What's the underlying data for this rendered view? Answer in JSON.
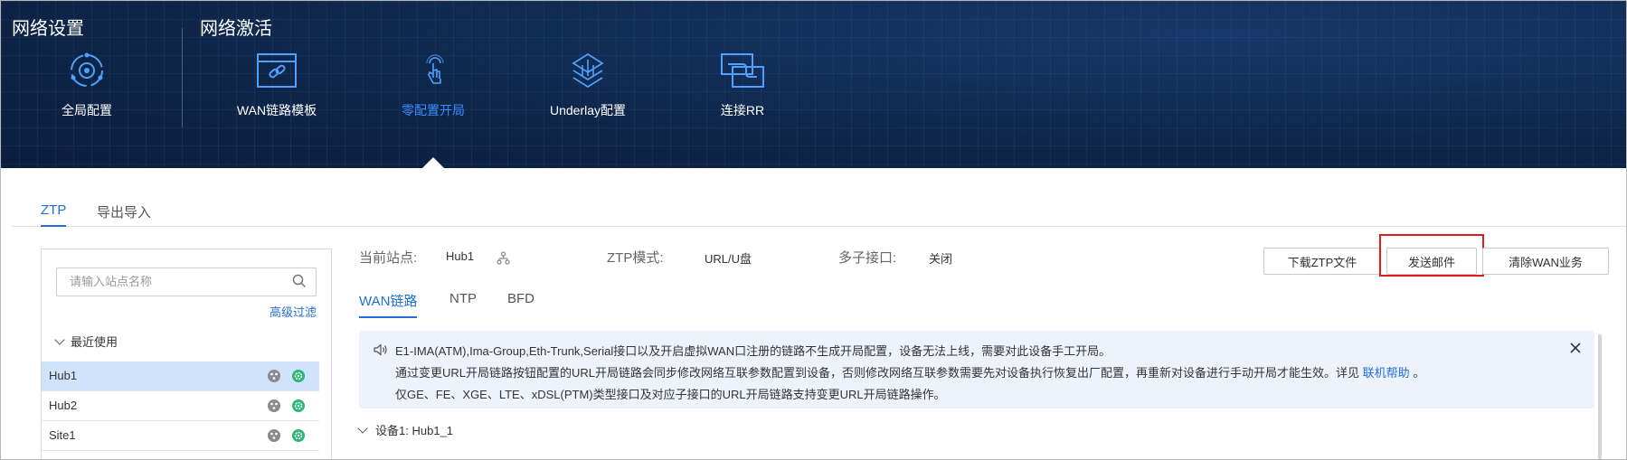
{
  "header": {
    "section_network_settings": "网络设置",
    "section_network_activation": "网络激活",
    "nav": [
      {
        "label": "全局配置",
        "icon": "gear-cycle-icon",
        "active": false
      },
      {
        "label": "WAN链路模板",
        "icon": "link-template-icon",
        "active": false
      },
      {
        "label": "零配置开局",
        "icon": "touch-hand-icon",
        "active": true
      },
      {
        "label": "Underlay配置",
        "icon": "layers-network-icon",
        "active": false
      },
      {
        "label": "连接RR",
        "icon": "connect-rr-icon",
        "active": false
      }
    ]
  },
  "tabs_top": [
    {
      "label": "ZTP",
      "active": true
    },
    {
      "label": "导出导入",
      "active": false
    }
  ],
  "left_panel": {
    "search_placeholder": "请输入站点名称",
    "advanced_filter": "高级过滤",
    "recent_label": "最近使用",
    "sites": [
      {
        "name": "Hub1",
        "selected": true
      },
      {
        "name": "Hub2",
        "selected": false
      },
      {
        "name": "Site1",
        "selected": false
      }
    ]
  },
  "info": {
    "current_site_label": "当前站点:",
    "current_site_value": "Hub1",
    "ztp_mode_label": "ZTP模式:",
    "ztp_mode_value": "URL/U盘",
    "multi_sub_label": "多子接口:",
    "multi_sub_value": "关闭"
  },
  "buttons": {
    "download_ztp": "下载ZTP文件",
    "send_email": "发送邮件",
    "clear_wan": "清除WAN业务"
  },
  "tabs_sub": [
    {
      "label": "WAN链路",
      "active": true
    },
    {
      "label": "NTP",
      "active": false
    },
    {
      "label": "BFD",
      "active": false
    }
  ],
  "notice": {
    "line1": "E1-IMA(ATM),Ima-Group,Eth-Trunk,Serial接口以及开启虚拟WAN口注册的链路不生成开局配置，设备无法上线，需要对此设备手工开局。",
    "line2": "通过变更URL开局链路按钮配置的URL开局链路会同步修改网络互联参数配置到设备，否则修改网络互联参数需要先对设备执行恢复出厂配置，再重新对设备进行手动开局才能生效。详见",
    "help_link": "联机帮助",
    "line2_end": "。",
    "line3": "仅GE、FE、XGE、LTE、xDSL(PTM)类型接口及对应子接口的URL开局链路支持变更URL开局链路操作。"
  },
  "device": {
    "label": "设备1:",
    "value": "Hub1_1"
  },
  "colors": {
    "accent": "#1f6fd6",
    "banner_bg": "#0e2548",
    "highlight": "#e11a1a",
    "selected_row": "#cfe3fb",
    "status_green": "#2bb673"
  }
}
